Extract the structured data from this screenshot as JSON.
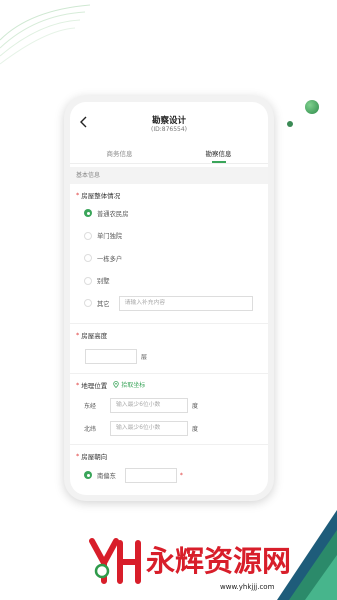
{
  "colors": {
    "accent": "#3aa55a",
    "required": "#e03c3c",
    "brand": "#d81e2a"
  },
  "header": {
    "title": "勘察设计",
    "id_label": "(ID:876554)"
  },
  "tabs": [
    {
      "label": "商务信息"
    },
    {
      "label": "勘察信息"
    }
  ],
  "section": {
    "title": "基本信息"
  },
  "house_type": {
    "label": "房屋整体情况",
    "options": [
      "普通农民房",
      "单门独院",
      "一栋多户",
      "别墅",
      "其它"
    ],
    "selected": "普通农民房",
    "other_placeholder": "请输入补充内容"
  },
  "house_height": {
    "label": "房屋高度",
    "unit": "层"
  },
  "location": {
    "label": "地理位置",
    "pick_label": "拾取坐标",
    "longitude_label": "东经",
    "latitude_label": "北纬",
    "placeholder": "输入最少6位小数",
    "unit": "度"
  },
  "orientation": {
    "label": "房屋朝向",
    "selected": "南偏东"
  },
  "watermark": {
    "brand": "永辉资源网",
    "site": "www.yhkjjj.com",
    "logo_text": "YH"
  },
  "icons": {
    "back": "chevron-left-icon",
    "locate": "location-pin-icon"
  }
}
